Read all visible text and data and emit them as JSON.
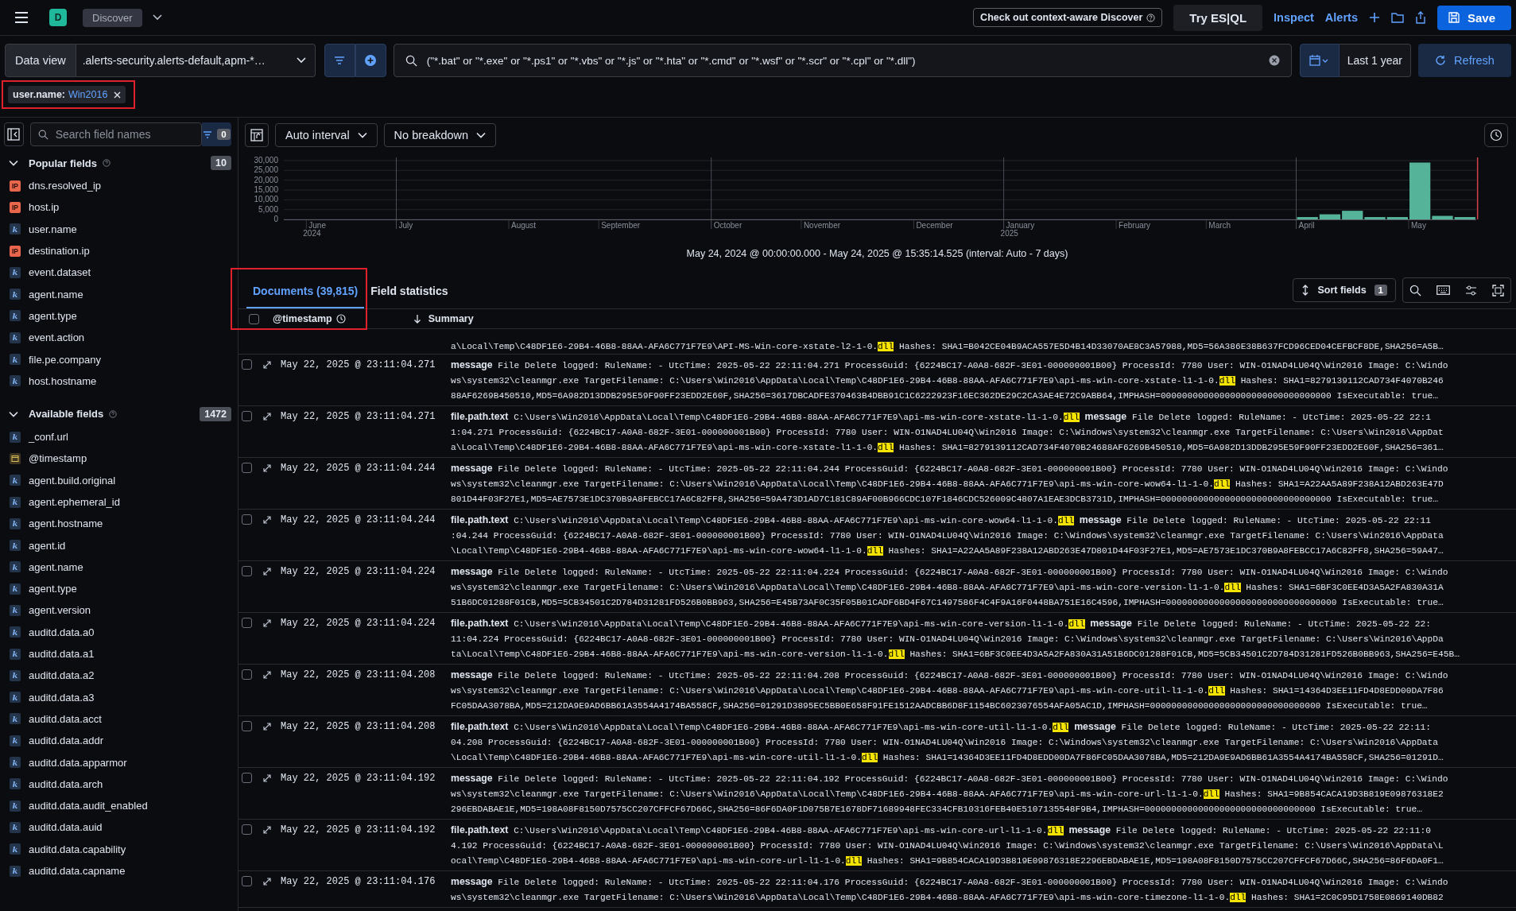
{
  "topbar": {
    "app_badge": "D",
    "app_name": "Discover",
    "promo": "Check out context-aware Discover",
    "esql_label": "Try ES|QL",
    "links": [
      "Inspect",
      "Alerts"
    ],
    "save_label": "Save"
  },
  "query_bar": {
    "data_view_label": "Data view",
    "data_view": ".alerts-security.alerts-default,apm-*…",
    "query": "(\"*.bat\" or \"*.exe\" or \"*.ps1\" or \"*.vbs\" or \"*.js\" or \"*.hta\" or \"*.cmd\" or \"*.wsf\" or \"*.scr\" or \"*.cpl\" or \"*.dll\")",
    "time_range": "Last 1 year",
    "refresh_label": "Refresh"
  },
  "filters": [
    {
      "field": "user.name:",
      "value": "Win2016",
      "highlighted": true
    }
  ],
  "sidebar": {
    "search_placeholder": "Search field names",
    "filter_count": "0",
    "sections": [
      {
        "title": "Popular fields",
        "count": "10",
        "expanded": true,
        "fields": [
          {
            "name": "dns.resolved_ip",
            "kind": "ip",
            "badge": "IP"
          },
          {
            "name": "host.ip",
            "kind": "ip",
            "badge": "IP"
          },
          {
            "name": "user.name",
            "kind": "keyword",
            "badge": "k"
          },
          {
            "name": "destination.ip",
            "kind": "ip",
            "badge": "IP"
          },
          {
            "name": "event.dataset",
            "kind": "keyword",
            "badge": "k"
          },
          {
            "name": "agent.name",
            "kind": "keyword",
            "badge": "k"
          },
          {
            "name": "agent.type",
            "kind": "keyword",
            "badge": "k"
          },
          {
            "name": "event.action",
            "kind": "keyword",
            "badge": "k"
          },
          {
            "name": "file.pe.company",
            "kind": "keyword",
            "badge": "k"
          },
          {
            "name": "host.hostname",
            "kind": "keyword",
            "badge": "k"
          }
        ]
      },
      {
        "title": "Available fields",
        "count": "1472",
        "expanded": true,
        "fields": [
          {
            "name": "_conf.url",
            "kind": "keyword",
            "badge": "k"
          },
          {
            "name": "@timestamp",
            "kind": "date"
          },
          {
            "name": "agent.build.original",
            "kind": "keyword",
            "badge": "k"
          },
          {
            "name": "agent.ephemeral_id",
            "kind": "keyword",
            "badge": "k"
          },
          {
            "name": "agent.hostname",
            "kind": "keyword",
            "badge": "k"
          },
          {
            "name": "agent.id",
            "kind": "keyword",
            "badge": "k"
          },
          {
            "name": "agent.name",
            "kind": "keyword",
            "badge": "k"
          },
          {
            "name": "agent.type",
            "kind": "keyword",
            "badge": "k"
          },
          {
            "name": "agent.version",
            "kind": "keyword",
            "badge": "k"
          },
          {
            "name": "auditd.data.a0",
            "kind": "keyword",
            "badge": "k"
          },
          {
            "name": "auditd.data.a1",
            "kind": "keyword",
            "badge": "k"
          },
          {
            "name": "auditd.data.a2",
            "kind": "keyword",
            "badge": "k"
          },
          {
            "name": "auditd.data.a3",
            "kind": "keyword",
            "badge": "k"
          },
          {
            "name": "auditd.data.acct",
            "kind": "keyword",
            "badge": "k"
          },
          {
            "name": "auditd.data.addr",
            "kind": "keyword",
            "badge": "k"
          },
          {
            "name": "auditd.data.apparmor",
            "kind": "keyword",
            "badge": "k"
          },
          {
            "name": "auditd.data.arch",
            "kind": "keyword",
            "badge": "k"
          },
          {
            "name": "auditd.data.audit_enabled",
            "kind": "keyword",
            "badge": "k"
          },
          {
            "name": "auditd.data.auid",
            "kind": "keyword",
            "badge": "k"
          },
          {
            "name": "auditd.data.capability",
            "kind": "keyword",
            "badge": "k"
          },
          {
            "name": "auditd.data.capname",
            "kind": "keyword",
            "badge": "k"
          }
        ]
      }
    ]
  },
  "histogram": {
    "interval": "Auto interval",
    "breakdown": "No breakdown",
    "chart_data": {
      "type": "bar",
      "categories": [
        null,
        "June\n2024",
        null,
        null,
        null,
        "July",
        null,
        null,
        null,
        null,
        "August",
        null,
        null,
        null,
        "September",
        null,
        null,
        null,
        null,
        "October",
        null,
        null,
        null,
        "November",
        null,
        null,
        null,
        null,
        "December",
        null,
        null,
        null,
        "January\n2025",
        null,
        null,
        null,
        null,
        "February",
        null,
        null,
        null,
        "March",
        null,
        null,
        null,
        "April",
        null,
        null,
        null,
        null,
        "May",
        null,
        null
      ],
      "values": [
        0,
        0,
        0,
        0,
        0,
        0,
        0,
        0,
        0,
        0,
        0,
        0,
        0,
        0,
        0,
        0,
        0,
        0,
        0,
        0,
        0,
        0,
        0,
        0,
        0,
        0,
        0,
        0,
        0,
        0,
        0,
        0,
        0,
        0,
        0,
        0,
        0,
        0,
        0,
        0,
        0,
        0,
        0,
        0,
        0,
        1200,
        2600,
        4400,
        1200,
        1200,
        29000,
        1800,
        1200
      ],
      "ylim": [
        0,
        30000
      ],
      "grid": true,
      "yticks": [
        {
          "value": 0,
          "label": "0"
        },
        {
          "value": 5000,
          "label": "5,000"
        },
        {
          "value": 10000,
          "label": "10,000"
        },
        {
          "value": 15000,
          "label": "15,000"
        },
        {
          "value": 20000,
          "label": "20,000"
        },
        {
          "value": 25000,
          "label": "25,000"
        },
        {
          "value": 30000,
          "label": "30,000"
        }
      ]
    },
    "range_text": "May 24, 2024 @ 00:00:00.000 - May 24, 2025 @ 15:35:14.525 (interval: Auto - 7 days)"
  },
  "tabs": [
    {
      "label": "Documents (39,815)",
      "selected": true
    },
    {
      "label": "Field statistics",
      "selected": false
    }
  ],
  "sort_fields": {
    "label": "Sort fields",
    "count": "1"
  },
  "table": {
    "highlighted": true,
    "select_all_checked": false,
    "columns": [
      "@timestamp",
      "Summary"
    ],
    "rows": [
      {
        "lines": [
          [
            {
              "kind": "text",
              "text": "a\\Local\\Temp\\C48DF1E6-29B4-46B8-88AA-AFA6C771F7E9\\API-MS-Win-core-xstate-l2-1-0."
            },
            {
              "kind": "match",
              "text": "dll"
            },
            {
              "kind": "text",
              "text": " Hashes: SHA1=B042CE04B9ACA557E5D4B14D33070AE8C3A57988,MD5=56A386E38B637FCD96CED04CEFBCF8DE,SHA256=A5B…"
            }
          ]
        ]
      },
      {
        "timestamp": "May 22, 2025 @ 23:11:04.271",
        "checked": false,
        "lines": [
          [
            {
              "kind": "field",
              "text": "message"
            },
            {
              "kind": "text",
              "text": " File Delete logged: RuleName: - UtcTime: 2025-05-22 22:11:04.271 ProcessGuid: {6224BC17-A0A8-682F-3E01-000000001B00} ProcessId: 7780 User: WIN-O1NAD4LU04Q\\Win2016 Image: C:\\Windo"
            }
          ],
          [
            {
              "kind": "text",
              "text": "ws\\system32\\cleanmgr.exe TargetFilename: C:\\Users\\Win2016\\AppData\\Local\\Temp\\C48DF1E6-29B4-46B8-88AA-AFA6C771F7E9\\api-ms-win-core-xstate-l1-1-0."
            },
            {
              "kind": "match",
              "text": "dll"
            },
            {
              "kind": "text",
              "text": " Hashes: SHA1=8279139112CAD734F4070B246"
            }
          ],
          [
            {
              "kind": "text",
              "text": "88AF6269B450510,MD5=6A982D13DDB295E59F90FF23EDD2E60F,SHA256=3617DBCADFE370463B4DBB91C1C6222923F16EC362DE29C2CA3AE4E72C9ABB64,IMPHASH=00000000000000000000000000000000 IsExecutable: true…"
            }
          ]
        ]
      },
      {
        "timestamp": "May 22, 2025 @ 23:11:04.271",
        "checked": false,
        "lines": [
          [
            {
              "kind": "field",
              "text": "file.path.text"
            },
            {
              "kind": "text",
              "text": " C:\\Users\\Win2016\\AppData\\Local\\Temp\\C48DF1E6-29B4-46B8-88AA-AFA6C771F7E9\\api-ms-win-core-xstate-l1-1-0."
            },
            {
              "kind": "match",
              "text": "dll"
            },
            {
              "kind": "field",
              "text": "message"
            },
            {
              "kind": "text",
              "text": " File Delete logged: RuleName: - UtcTime: 2025-05-22 22:1"
            }
          ],
          [
            {
              "kind": "text",
              "text": "1:04.271 ProcessGuid: {6224BC17-A0A8-682F-3E01-000000001B00} ProcessId: 7780 User: WIN-O1NAD4LU04Q\\Win2016 Image: C:\\Windows\\system32\\cleanmgr.exe TargetFilename: C:\\Users\\Win2016\\AppDat"
            }
          ],
          [
            {
              "kind": "text",
              "text": "a\\Local\\Temp\\C48DF1E6-29B4-46B8-88AA-AFA6C771F7E9\\api-ms-win-core-xstate-l1-1-0."
            },
            {
              "kind": "match",
              "text": "dll"
            },
            {
              "kind": "text",
              "text": " Hashes: SHA1=8279139112CAD734F4070B24688AF6269B450510,MD5=6A982D13DDB295E59F90FF23EDD2E60F,SHA256=361…"
            }
          ]
        ]
      },
      {
        "timestamp": "May 22, 2025 @ 23:11:04.244",
        "checked": false,
        "lines": [
          [
            {
              "kind": "field",
              "text": "message"
            },
            {
              "kind": "text",
              "text": " File Delete logged: RuleName: - UtcTime: 2025-05-22 22:11:04.244 ProcessGuid: {6224BC17-A0A8-682F-3E01-000000001B00} ProcessId: 7780 User: WIN-O1NAD4LU04Q\\Win2016 Image: C:\\Windo"
            }
          ],
          [
            {
              "kind": "text",
              "text": "ws\\system32\\cleanmgr.exe TargetFilename: C:\\Users\\Win2016\\AppData\\Local\\Temp\\C48DF1E6-29B4-46B8-88AA-AFA6C771F7E9\\api-ms-win-core-wow64-l1-1-0."
            },
            {
              "kind": "match",
              "text": "dll"
            },
            {
              "kind": "text",
              "text": " Hashes: SHA1=A22AA5A89F238A12ABD263E47D"
            }
          ],
          [
            {
              "kind": "text",
              "text": "801D44F03F27E1,MD5=AE7573E1DC370B9A8FEBCC17A6C82FF8,SHA256=59A473D1AD7C181C89AF00B966CDC107F1846CDC526009C4807A1EAE3DCB3731D,IMPHASH=00000000000000000000000000000000 IsExecutable: true…"
            }
          ]
        ]
      },
      {
        "timestamp": "May 22, 2025 @ 23:11:04.244",
        "checked": false,
        "lines": [
          [
            {
              "kind": "field",
              "text": "file.path.text"
            },
            {
              "kind": "text",
              "text": " C:\\Users\\Win2016\\AppData\\Local\\Temp\\C48DF1E6-29B4-46B8-88AA-AFA6C771F7E9\\api-ms-win-core-wow64-l1-1-0."
            },
            {
              "kind": "match",
              "text": "dll"
            },
            {
              "kind": "field",
              "text": "message"
            },
            {
              "kind": "text",
              "text": " File Delete logged: RuleName: - UtcTime: 2025-05-22 22:11"
            }
          ],
          [
            {
              "kind": "text",
              "text": ":04.244 ProcessGuid: {6224BC17-A0A8-682F-3E01-000000001B00} ProcessId: 7780 User: WIN-O1NAD4LU04Q\\Win2016 Image: C:\\Windows\\system32\\cleanmgr.exe TargetFilename: C:\\Users\\Win2016\\AppData"
            }
          ],
          [
            {
              "kind": "text",
              "text": "\\Local\\Temp\\C48DF1E6-29B4-46B8-88AA-AFA6C771F7E9\\api-ms-win-core-wow64-l1-1-0."
            },
            {
              "kind": "match",
              "text": "dll"
            },
            {
              "kind": "text",
              "text": " Hashes: SHA1=A22AA5A89F238A12ABD263E47D801D44F03F27E1,MD5=AE7573E1DC370B9A8FEBCC17A6C82FF8,SHA256=59A47…"
            }
          ]
        ]
      },
      {
        "timestamp": "May 22, 2025 @ 23:11:04.224",
        "checked": false,
        "lines": [
          [
            {
              "kind": "field",
              "text": "message"
            },
            {
              "kind": "text",
              "text": " File Delete logged: RuleName: - UtcTime: 2025-05-22 22:11:04.224 ProcessGuid: {6224BC17-A0A8-682F-3E01-000000001B00} ProcessId: 7780 User: WIN-O1NAD4LU04Q\\Win2016 Image: C:\\Windo"
            }
          ],
          [
            {
              "kind": "text",
              "text": "ws\\system32\\cleanmgr.exe TargetFilename: C:\\Users\\Win2016\\AppData\\Local\\Temp\\C48DF1E6-29B4-46B8-88AA-AFA6C771F7E9\\api-ms-win-core-version-l1-1-0."
            },
            {
              "kind": "match",
              "text": "dll"
            },
            {
              "kind": "text",
              "text": " Hashes: SHA1=6BF3C0EE4D3A5A2FA830A31A"
            }
          ],
          [
            {
              "kind": "text",
              "text": "51B6DC01288F01CB,MD5=5CB34501C2D784D31281FD526B0BB963,SHA256=E45B73AF0C35F05B01CADF6BD4F67C1497586F4C4F9A16F0448BA751E16C4596,IMPHASH=00000000000000000000000000000000 IsExecutable: true…"
            }
          ]
        ]
      },
      {
        "timestamp": "May 22, 2025 @ 23:11:04.224",
        "checked": false,
        "lines": [
          [
            {
              "kind": "field",
              "text": "file.path.text"
            },
            {
              "kind": "text",
              "text": " C:\\Users\\Win2016\\AppData\\Local\\Temp\\C48DF1E6-29B4-46B8-88AA-AFA6C771F7E9\\api-ms-win-core-version-l1-1-0."
            },
            {
              "kind": "match",
              "text": "dll"
            },
            {
              "kind": "field",
              "text": "message"
            },
            {
              "kind": "text",
              "text": " File Delete logged: RuleName: - UtcTime: 2025-05-22 22:"
            }
          ],
          [
            {
              "kind": "text",
              "text": "11:04.224 ProcessGuid: {6224BC17-A0A8-682F-3E01-000000001B00} ProcessId: 7780 User: WIN-O1NAD4LU04Q\\Win2016 Image: C:\\Windows\\system32\\cleanmgr.exe TargetFilename: C:\\Users\\Win2016\\AppDa"
            }
          ],
          [
            {
              "kind": "text",
              "text": "ta\\Local\\Temp\\C48DF1E6-29B4-46B8-88AA-AFA6C771F7E9\\api-ms-win-core-version-l1-1-0."
            },
            {
              "kind": "match",
              "text": "dll"
            },
            {
              "kind": "text",
              "text": " Hashes: SHA1=6BF3C0EE4D3A5A2FA830A31A51B6DC01288F01CB,MD5=5CB34501C2D784D31281FD526B0BB963,SHA256=E45B…"
            }
          ]
        ]
      },
      {
        "timestamp": "May 22, 2025 @ 23:11:04.208",
        "checked": false,
        "lines": [
          [
            {
              "kind": "field",
              "text": "message"
            },
            {
              "kind": "text",
              "text": " File Delete logged: RuleName: - UtcTime: 2025-05-22 22:11:04.208 ProcessGuid: {6224BC17-A0A8-682F-3E01-000000001B00} ProcessId: 7780 User: WIN-O1NAD4LU04Q\\Win2016 Image: C:\\Windo"
            }
          ],
          [
            {
              "kind": "text",
              "text": "ws\\system32\\cleanmgr.exe TargetFilename: C:\\Users\\Win2016\\AppData\\Local\\Temp\\C48DF1E6-29B4-46B8-88AA-AFA6C771F7E9\\api-ms-win-core-util-l1-1-0."
            },
            {
              "kind": "match",
              "text": "dll"
            },
            {
              "kind": "text",
              "text": " Hashes: SHA1=14364D3EE11FD4D8EDD00DA7F86"
            }
          ],
          [
            {
              "kind": "text",
              "text": "FC05DAA3078BA,MD5=212DA9E9AD6BB61A3554A4174BA558CF,SHA256=01291D3895EC5BB0E658F91FE1512AADCBB6D8F1154BC6023076554AFA05AC1D,IMPHASH=00000000000000000000000000000000 IsExecutable: true…"
            }
          ]
        ]
      },
      {
        "timestamp": "May 22, 2025 @ 23:11:04.208",
        "checked": false,
        "lines": [
          [
            {
              "kind": "field",
              "text": "file.path.text"
            },
            {
              "kind": "text",
              "text": " C:\\Users\\Win2016\\AppData\\Local\\Temp\\C48DF1E6-29B4-46B8-88AA-AFA6C771F7E9\\api-ms-win-core-util-l1-1-0."
            },
            {
              "kind": "match",
              "text": "dll"
            },
            {
              "kind": "field",
              "text": "message"
            },
            {
              "kind": "text",
              "text": " File Delete logged: RuleName: - UtcTime: 2025-05-22 22:11:"
            }
          ],
          [
            {
              "kind": "text",
              "text": "04.208 ProcessGuid: {6224BC17-A0A8-682F-3E01-000000001B00} ProcessId: 7780 User: WIN-O1NAD4LU04Q\\Win2016 Image: C:\\Windows\\system32\\cleanmgr.exe TargetFilename: C:\\Users\\Win2016\\AppData"
            }
          ],
          [
            {
              "kind": "text",
              "text": "\\Local\\Temp\\C48DF1E6-29B4-46B8-88AA-AFA6C771F7E9\\api-ms-win-core-util-l1-1-0."
            },
            {
              "kind": "match",
              "text": "dll"
            },
            {
              "kind": "text",
              "text": " Hashes: SHA1=14364D3EE11FD4D8EDD00DA7F86FC05DAA3078BA,MD5=212DA9E9AD6BB61A3554A4174BA558CF,SHA256=01291D…"
            }
          ]
        ]
      },
      {
        "timestamp": "May 22, 2025 @ 23:11:04.192",
        "checked": false,
        "lines": [
          [
            {
              "kind": "field",
              "text": "message"
            },
            {
              "kind": "text",
              "text": " File Delete logged: RuleName: - UtcTime: 2025-05-22 22:11:04.192 ProcessGuid: {6224BC17-A0A8-682F-3E01-000000001B00} ProcessId: 7780 User: WIN-O1NAD4LU04Q\\Win2016 Image: C:\\Windo"
            }
          ],
          [
            {
              "kind": "text",
              "text": "ws\\system32\\cleanmgr.exe TargetFilename: C:\\Users\\Win2016\\AppData\\Local\\Temp\\C48DF1E6-29B4-46B8-88AA-AFA6C771F7E9\\api-ms-win-core-url-l1-1-0."
            },
            {
              "kind": "match",
              "text": "dll"
            },
            {
              "kind": "text",
              "text": " Hashes: SHA1=9B854CACA19D3B819E09876318E2"
            }
          ],
          [
            {
              "kind": "text",
              "text": "296EBDABAE1E,MD5=198A08F8150D7575CC207CFFCF67D66C,SHA256=86F6DA0F1D075B7E1678DF71689948FEC334CFB10316FEB40E5107135548F9B4,IMPHASH=00000000000000000000000000000000 IsExecutable: true…"
            }
          ]
        ]
      },
      {
        "timestamp": "May 22, 2025 @ 23:11:04.192",
        "checked": false,
        "lines": [
          [
            {
              "kind": "field",
              "text": "file.path.text"
            },
            {
              "kind": "text",
              "text": " C:\\Users\\Win2016\\AppData\\Local\\Temp\\C48DF1E6-29B4-46B8-88AA-AFA6C771F7E9\\api-ms-win-core-url-l1-1-0."
            },
            {
              "kind": "match",
              "text": "dll"
            },
            {
              "kind": "field",
              "text": "message"
            },
            {
              "kind": "text",
              "text": " File Delete logged: RuleName: - UtcTime: 2025-05-22 22:11:0"
            }
          ],
          [
            {
              "kind": "text",
              "text": "4.192 ProcessGuid: {6224BC17-A0A8-682F-3E01-000000001B00} ProcessId: 7780 User: WIN-O1NAD4LU04Q\\Win2016 Image: C:\\Windows\\system32\\cleanmgr.exe TargetFilename: C:\\Users\\Win2016\\AppData\\L"
            }
          ],
          [
            {
              "kind": "text",
              "text": "ocal\\Temp\\C48DF1E6-29B4-46B8-88AA-AFA6C771F7E9\\api-ms-win-core-url-l1-1-0."
            },
            {
              "kind": "match",
              "text": "dll"
            },
            {
              "kind": "text",
              "text": " Hashes: SHA1=9B854CACA19D3B819E09876318E2296EBDABAE1E,MD5=198A08F8150D7575CC207CFFCF67D66C,SHA256=86F6DA0F1…"
            }
          ]
        ]
      },
      {
        "timestamp": "May 22, 2025 @ 23:11:04.176",
        "checked": false,
        "lines": [
          [
            {
              "kind": "field",
              "text": "message"
            },
            {
              "kind": "text",
              "text": " File Delete logged: RuleName: - UtcTime: 2025-05-22 22:11:04.176 ProcessGuid: {6224BC17-A0A8-682F-3E01-000000001B00} ProcessId: 7780 User: WIN-O1NAD4LU04Q\\Win2016 Image: C:\\Windo"
            }
          ],
          [
            {
              "kind": "text",
              "text": "ws\\system32\\cleanmgr.exe TargetFilename: C:\\Users\\Win2016\\AppData\\Local\\Temp\\C48DF1E6-29B4-46B8-88AA-AFA6C771F7E9\\api-ms-win-core-timezone-l1-1-0."
            },
            {
              "kind": "match",
              "text": "dll"
            },
            {
              "kind": "text",
              "text": " Hashes: SHA1=2C0C95D1758E0869140DB82"
            }
          ]
        ]
      }
    ]
  }
}
